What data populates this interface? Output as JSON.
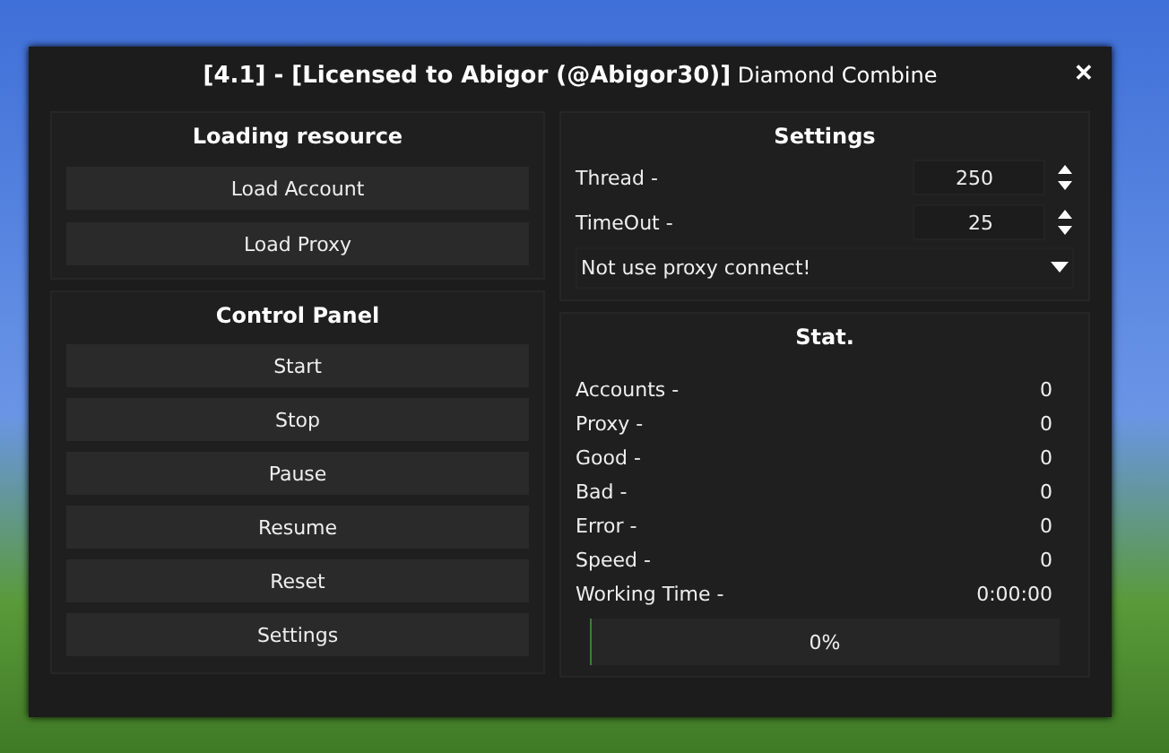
{
  "window": {
    "title": "**[4.1] - [Licensed to Abigor (@Abigor30)]** Diamond Combine",
    "close": "✕"
  },
  "loading": {
    "title": "Loading resource",
    "buttons": [
      "Load Account",
      "Load Proxy"
    ]
  },
  "control": {
    "title": "Control Panel",
    "buttons": [
      "Start",
      "Stop",
      "Pause",
      "Resume",
      "Reset",
      "Settings"
    ]
  },
  "settings": {
    "title": "Settings",
    "spinners": [
      {
        "label": "Thread -",
        "value": "250"
      },
      {
        "label": "TimeOut -",
        "value": "25"
      }
    ],
    "dropdown": {
      "value": "Not use proxy connect!"
    }
  },
  "stat": {
    "title": "Stat.",
    "rows": [
      {
        "label": "Accounts -",
        "value": "0"
      },
      {
        "label": "Proxy -",
        "value": "0"
      },
      {
        "label": "Good -",
        "value": "0"
      },
      {
        "label": "Bad -",
        "value": "0"
      },
      {
        "label": "Error -",
        "value": "0"
      },
      {
        "label": "Speed -",
        "value": "0"
      },
      {
        "label": "Working Time -",
        "value": "0:00:00"
      }
    ],
    "progress": {
      "level": 0,
      "text": "0%"
    }
  }
}
